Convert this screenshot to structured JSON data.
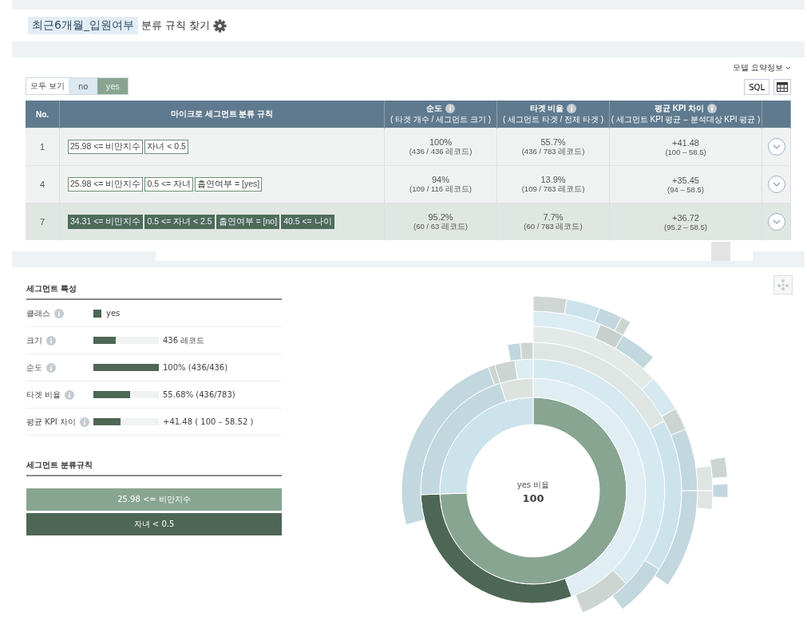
{
  "header": {
    "dataset": "최근6개월_입원여부",
    "title": "분류 규칙 찾기"
  },
  "filter": {
    "options": [
      {
        "label": "모두 보기",
        "selected": false
      },
      {
        "label": "no",
        "selected": false
      },
      {
        "label": "yes",
        "selected": true
      }
    ]
  },
  "model_summary_link": "모델 요약정보",
  "sql_button": "SQL",
  "table": {
    "columns": [
      {
        "title": "No."
      },
      {
        "title": "마이크로 세그먼트 분류 규칙"
      },
      {
        "title": "순도",
        "subtitle": "( 타겟 개수 / 세그먼트 크기 )"
      },
      {
        "title": "타겟 비율",
        "subtitle": "( 세그먼트 타겟 / 전체 타겟 )"
      },
      {
        "title": "평균 KPI 차이",
        "subtitle": "( 세그먼트 KPI 평균 – 분석대상 KPI 평균 )"
      }
    ],
    "rows": [
      {
        "no": "1",
        "rules": [
          "25.98 <= 비만지수",
          "자녀 < 0.5"
        ],
        "purity": "100%",
        "purity_sub": "(436 / 436 레코드)",
        "target": "55.7%",
        "target_sub": "(436 / 783 레코드)",
        "kpi": "+41.48",
        "kpi_sub": "(100 – 58.5)",
        "selected": false
      },
      {
        "no": "4",
        "rules": [
          "25.98 <= 비만지수",
          "0.5 <= 자녀",
          "흡연여부 = [yes]"
        ],
        "purity": "94%",
        "purity_sub": "(109 / 116 레코드)",
        "target": "13.9%",
        "target_sub": "(109 / 783 레코드)",
        "kpi": "+35.45",
        "kpi_sub": "(94 – 58.5)",
        "selected": false
      },
      {
        "no": "7",
        "rules": [
          "34.31 <= 비만지수",
          "0.5 <= 자녀 < 2.5",
          "흡연여부 = [no]",
          "40.5 <= 나이"
        ],
        "purity": "95.2%",
        "purity_sub": "(60 / 63 레코드)",
        "target": "7.7%",
        "target_sub": "(60 / 783 레코드)",
        "kpi": "+36.72",
        "kpi_sub": "(95.2 – 58.5)",
        "selected": true
      }
    ]
  },
  "segment_traits": {
    "title": "세그먼트 특성",
    "items": [
      {
        "label": "클래스",
        "kind": "swatch",
        "color": "#4e6655",
        "value": "yes"
      },
      {
        "label": "크기",
        "kind": "bar",
        "level": 0.34,
        "value": "436 레코드"
      },
      {
        "label": "순도",
        "kind": "bar",
        "level": 1.0,
        "value": "100% (436/436)"
      },
      {
        "label": "타겟 비율",
        "kind": "bar",
        "level": 0.56,
        "value": "55.68% (436/783)"
      },
      {
        "label": "평균 KPI 차이",
        "kind": "bar",
        "level": 0.41,
        "value": "+41.48 ( 100 – 58.52 )"
      }
    ]
  },
  "segment_rules": {
    "title": "세그먼트 분류규칙",
    "items": [
      {
        "label": "25.98 <= 비만지수",
        "color": "#88a592"
      },
      {
        "label": "자녀 < 0.5",
        "color": "#4e6655"
      }
    ]
  },
  "sunburst": {
    "center_label": "yes 비율",
    "center_value": "100"
  }
}
